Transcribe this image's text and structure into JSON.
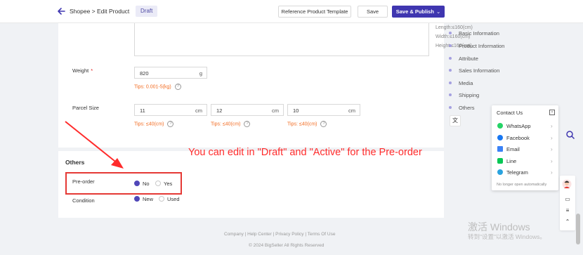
{
  "header": {
    "breadcrumb": "Shopee > Edit Product",
    "status_badge": "Draft",
    "reference_button": "Reference Product Template",
    "save_button": "Save",
    "publish_button": "Save & Publish"
  },
  "dimension_hints": {
    "length": "Length:≤160(cm)",
    "width": "Width:≤160(cm)",
    "height": "Height:≤160(cm)"
  },
  "weight": {
    "label": "Weight",
    "required_mark": "*",
    "value": "820",
    "unit": "g",
    "tip": "Tips: 0.001-5(kg)"
  },
  "parcel_size": {
    "label": "Parcel Size",
    "fields": [
      {
        "value": "11",
        "unit": "cm",
        "tip": "Tips: ≤40(cm)"
      },
      {
        "value": "12",
        "unit": "cm",
        "tip": "Tips: ≤40(cm)"
      },
      {
        "value": "10",
        "unit": "cm",
        "tip": "Tips: ≤40(cm)"
      }
    ]
  },
  "others": {
    "title": "Others",
    "preorder_label": "Pre-order",
    "preorder_options": [
      "No",
      "Yes"
    ],
    "preorder_selected": "No",
    "condition_label": "Condition",
    "condition_options": [
      "New",
      "Used"
    ],
    "condition_selected": "New"
  },
  "annotation": {
    "text": "You can edit in \"Draft\" and \"Active\" for the Pre-order",
    "color": "#ff2b2b"
  },
  "side_nav": {
    "items": [
      "Basic Information",
      "Product Information",
      "Attribute",
      "Sales Information",
      "Media",
      "Shipping",
      "Others"
    ]
  },
  "contact": {
    "title": "Contact Us",
    "items": [
      {
        "label": "WhatsApp",
        "color": "#25d366"
      },
      {
        "label": "Facebook",
        "color": "#1877f2"
      },
      {
        "label": "Email",
        "color": "#3b82f6"
      },
      {
        "label": "Line",
        "color": "#06c755"
      },
      {
        "label": "Telegram",
        "color": "#2aa3df"
      }
    ],
    "footer": "No longer open automatically"
  },
  "footer": {
    "links": "Company  |  Help Center  |  Privacy Policy  |  Terms Of Use",
    "copyright": "© 2024 BigSeller All Rights Reserved"
  },
  "watermark": {
    "line1": "激活 Windows",
    "line2": "转到\"设置\"以激活 Windows。"
  },
  "colors": {
    "accent": "#3f36b0",
    "tip": "#f26b21",
    "highlight": "#e53935"
  }
}
